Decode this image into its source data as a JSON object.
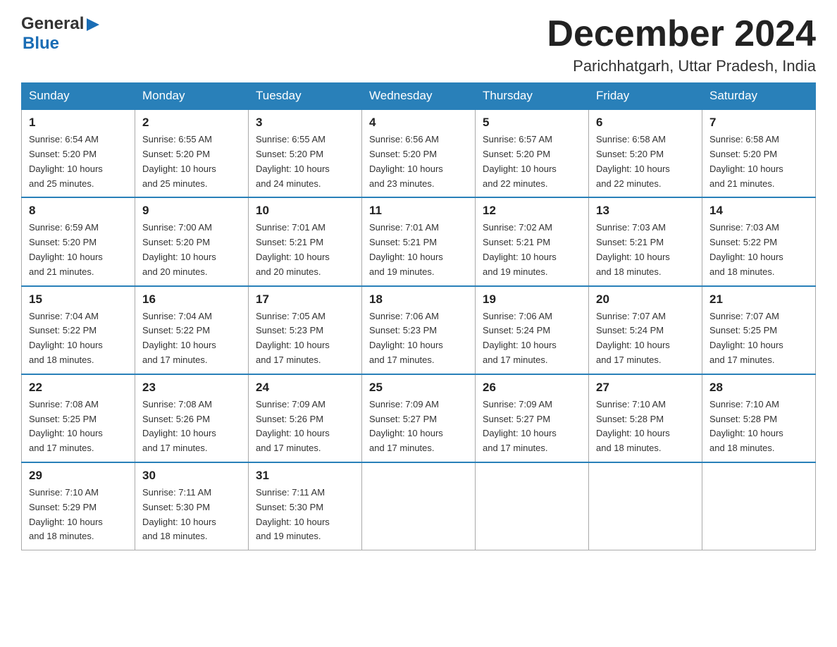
{
  "header": {
    "logo_general": "General",
    "logo_blue": "Blue",
    "title": "December 2024",
    "subtitle": "Parichhatgarh, Uttar Pradesh, India"
  },
  "days_header": [
    "Sunday",
    "Monday",
    "Tuesday",
    "Wednesday",
    "Thursday",
    "Friday",
    "Saturday"
  ],
  "weeks": [
    [
      {
        "day": "1",
        "sunrise": "6:54 AM",
        "sunset": "5:20 PM",
        "daylight": "10 hours and 25 minutes."
      },
      {
        "day": "2",
        "sunrise": "6:55 AM",
        "sunset": "5:20 PM",
        "daylight": "10 hours and 25 minutes."
      },
      {
        "day": "3",
        "sunrise": "6:55 AM",
        "sunset": "5:20 PM",
        "daylight": "10 hours and 24 minutes."
      },
      {
        "day": "4",
        "sunrise": "6:56 AM",
        "sunset": "5:20 PM",
        "daylight": "10 hours and 23 minutes."
      },
      {
        "day": "5",
        "sunrise": "6:57 AM",
        "sunset": "5:20 PM",
        "daylight": "10 hours and 22 minutes."
      },
      {
        "day": "6",
        "sunrise": "6:58 AM",
        "sunset": "5:20 PM",
        "daylight": "10 hours and 22 minutes."
      },
      {
        "day": "7",
        "sunrise": "6:58 AM",
        "sunset": "5:20 PM",
        "daylight": "10 hours and 21 minutes."
      }
    ],
    [
      {
        "day": "8",
        "sunrise": "6:59 AM",
        "sunset": "5:20 PM",
        "daylight": "10 hours and 21 minutes."
      },
      {
        "day": "9",
        "sunrise": "7:00 AM",
        "sunset": "5:20 PM",
        "daylight": "10 hours and 20 minutes."
      },
      {
        "day": "10",
        "sunrise": "7:01 AM",
        "sunset": "5:21 PM",
        "daylight": "10 hours and 20 minutes."
      },
      {
        "day": "11",
        "sunrise": "7:01 AM",
        "sunset": "5:21 PM",
        "daylight": "10 hours and 19 minutes."
      },
      {
        "day": "12",
        "sunrise": "7:02 AM",
        "sunset": "5:21 PM",
        "daylight": "10 hours and 19 minutes."
      },
      {
        "day": "13",
        "sunrise": "7:03 AM",
        "sunset": "5:21 PM",
        "daylight": "10 hours and 18 minutes."
      },
      {
        "day": "14",
        "sunrise": "7:03 AM",
        "sunset": "5:22 PM",
        "daylight": "10 hours and 18 minutes."
      }
    ],
    [
      {
        "day": "15",
        "sunrise": "7:04 AM",
        "sunset": "5:22 PM",
        "daylight": "10 hours and 18 minutes."
      },
      {
        "day": "16",
        "sunrise": "7:04 AM",
        "sunset": "5:22 PM",
        "daylight": "10 hours and 17 minutes."
      },
      {
        "day": "17",
        "sunrise": "7:05 AM",
        "sunset": "5:23 PM",
        "daylight": "10 hours and 17 minutes."
      },
      {
        "day": "18",
        "sunrise": "7:06 AM",
        "sunset": "5:23 PM",
        "daylight": "10 hours and 17 minutes."
      },
      {
        "day": "19",
        "sunrise": "7:06 AM",
        "sunset": "5:24 PM",
        "daylight": "10 hours and 17 minutes."
      },
      {
        "day": "20",
        "sunrise": "7:07 AM",
        "sunset": "5:24 PM",
        "daylight": "10 hours and 17 minutes."
      },
      {
        "day": "21",
        "sunrise": "7:07 AM",
        "sunset": "5:25 PM",
        "daylight": "10 hours and 17 minutes."
      }
    ],
    [
      {
        "day": "22",
        "sunrise": "7:08 AM",
        "sunset": "5:25 PM",
        "daylight": "10 hours and 17 minutes."
      },
      {
        "day": "23",
        "sunrise": "7:08 AM",
        "sunset": "5:26 PM",
        "daylight": "10 hours and 17 minutes."
      },
      {
        "day": "24",
        "sunrise": "7:09 AM",
        "sunset": "5:26 PM",
        "daylight": "10 hours and 17 minutes."
      },
      {
        "day": "25",
        "sunrise": "7:09 AM",
        "sunset": "5:27 PM",
        "daylight": "10 hours and 17 minutes."
      },
      {
        "day": "26",
        "sunrise": "7:09 AM",
        "sunset": "5:27 PM",
        "daylight": "10 hours and 17 minutes."
      },
      {
        "day": "27",
        "sunrise": "7:10 AM",
        "sunset": "5:28 PM",
        "daylight": "10 hours and 18 minutes."
      },
      {
        "day": "28",
        "sunrise": "7:10 AM",
        "sunset": "5:28 PM",
        "daylight": "10 hours and 18 minutes."
      }
    ],
    [
      {
        "day": "29",
        "sunrise": "7:10 AM",
        "sunset": "5:29 PM",
        "daylight": "10 hours and 18 minutes."
      },
      {
        "day": "30",
        "sunrise": "7:11 AM",
        "sunset": "5:30 PM",
        "daylight": "10 hours and 18 minutes."
      },
      {
        "day": "31",
        "sunrise": "7:11 AM",
        "sunset": "5:30 PM",
        "daylight": "10 hours and 19 minutes."
      },
      null,
      null,
      null,
      null
    ]
  ],
  "labels": {
    "sunrise": "Sunrise:",
    "sunset": "Sunset:",
    "daylight": "Daylight:"
  }
}
